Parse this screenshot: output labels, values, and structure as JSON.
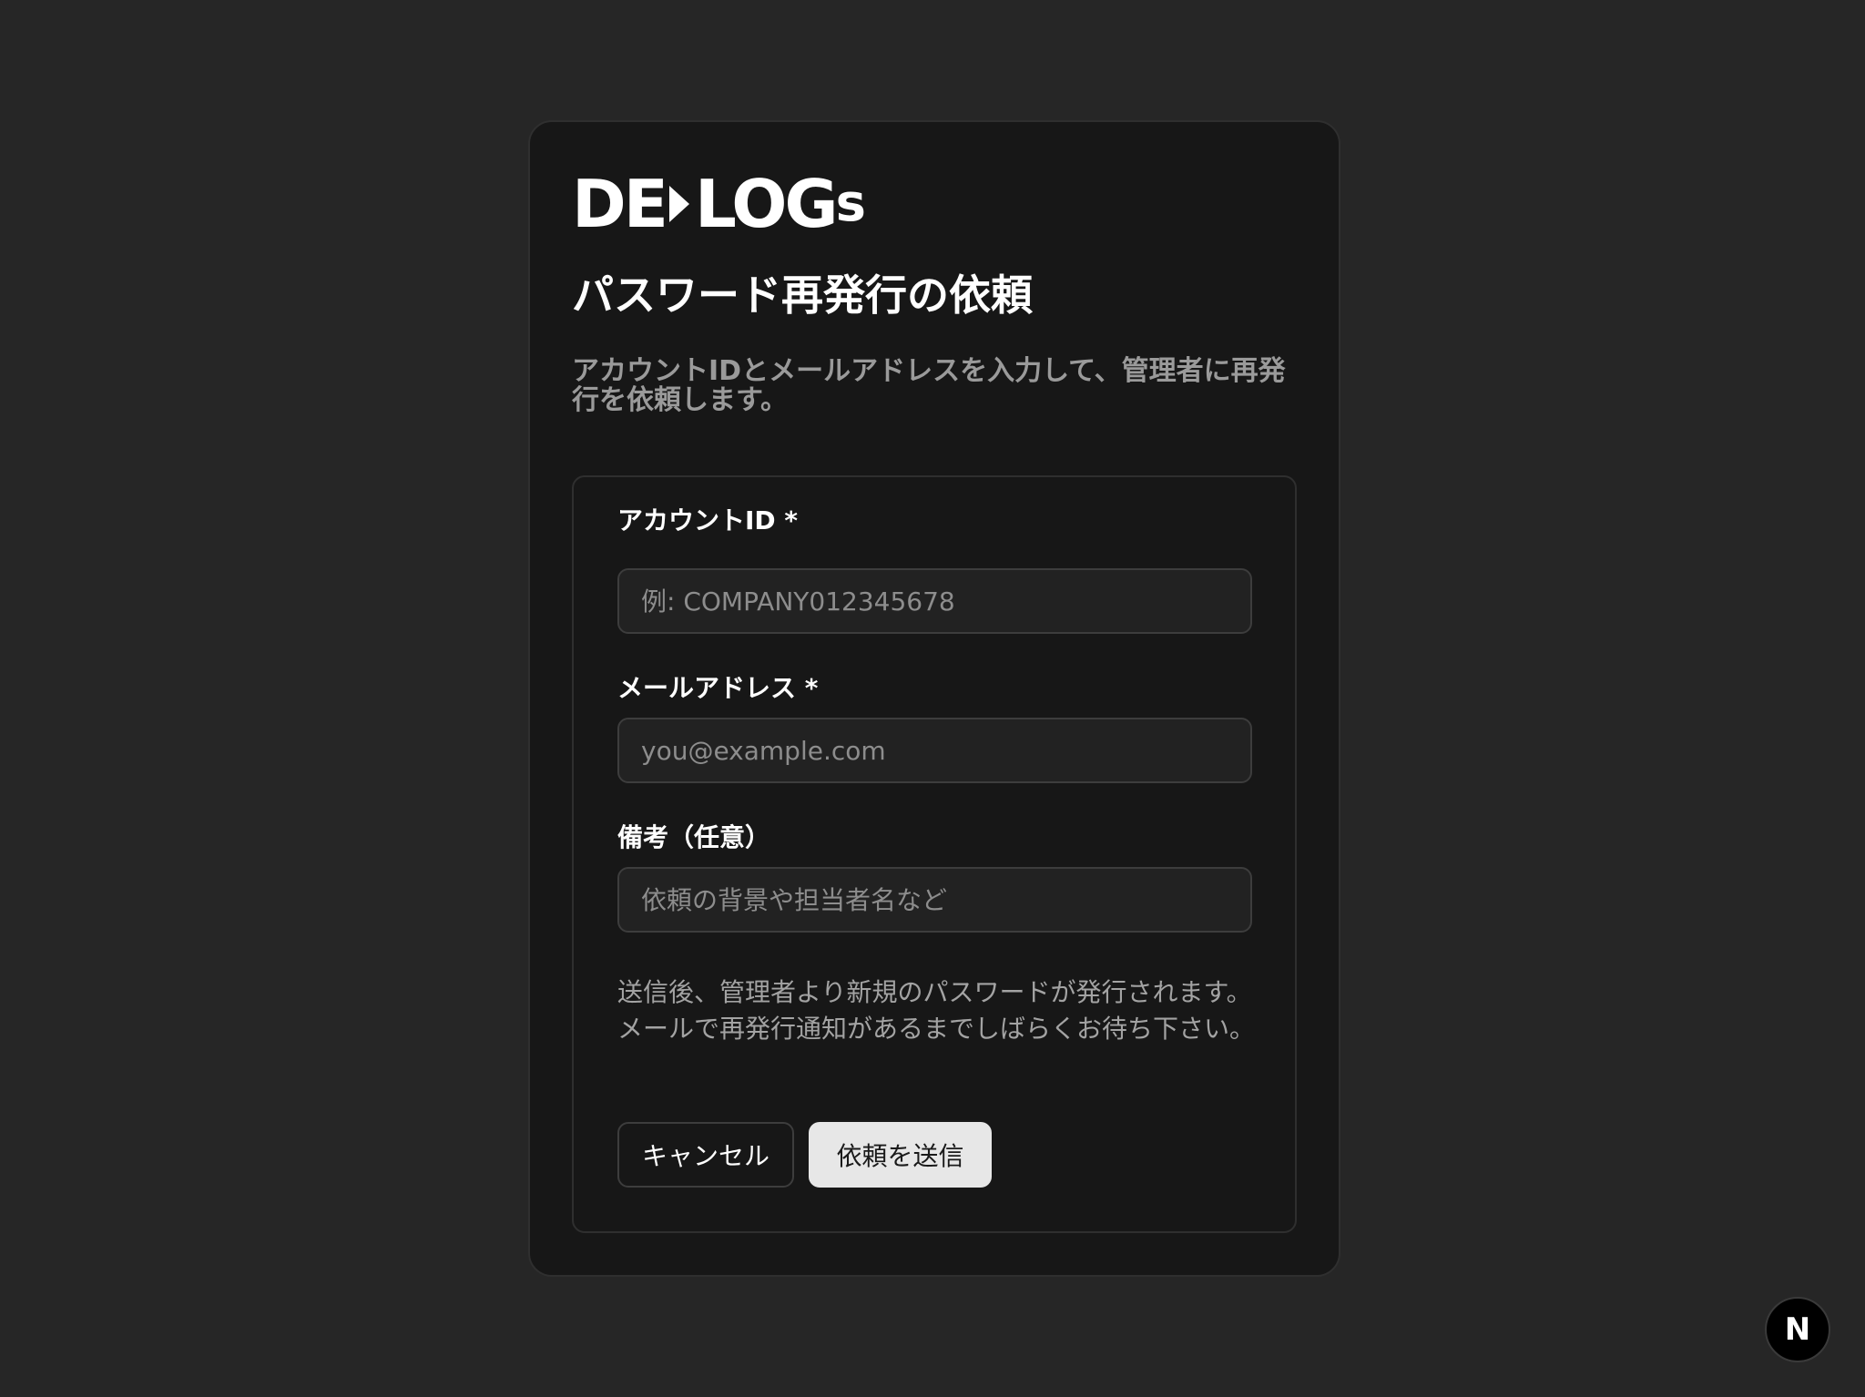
{
  "brand": {
    "logo_part1": "DE",
    "logo_part2": "LOG",
    "logo_part3": "s"
  },
  "page": {
    "title": "パスワード再発行の依頼",
    "subtitle": "アカウントIDとメールアドレスを入力して、管理者に再発行を依頼します。"
  },
  "form": {
    "account_id": {
      "label": "アカウントID *",
      "placeholder": "例: COMPANY012345678",
      "value": ""
    },
    "email": {
      "label": "メールアドレス *",
      "placeholder": "you@example.com",
      "value": ""
    },
    "remarks": {
      "label": "備考（任意）",
      "placeholder": "依頼の背景や担当者名など",
      "value": ""
    },
    "note": "送信後、管理者より新規のパスワードが発行されます。メールで再発行通知があるまでしばらくお待ち下さい。",
    "cancel_label": "キャンセル",
    "submit_label": "依頼を送信"
  },
  "dev_badge": {
    "label": "N",
    "icon": "nextjs-icon"
  },
  "colors": {
    "background": "#262626",
    "card": "#171717",
    "submit_button": "#e7e7e7"
  }
}
